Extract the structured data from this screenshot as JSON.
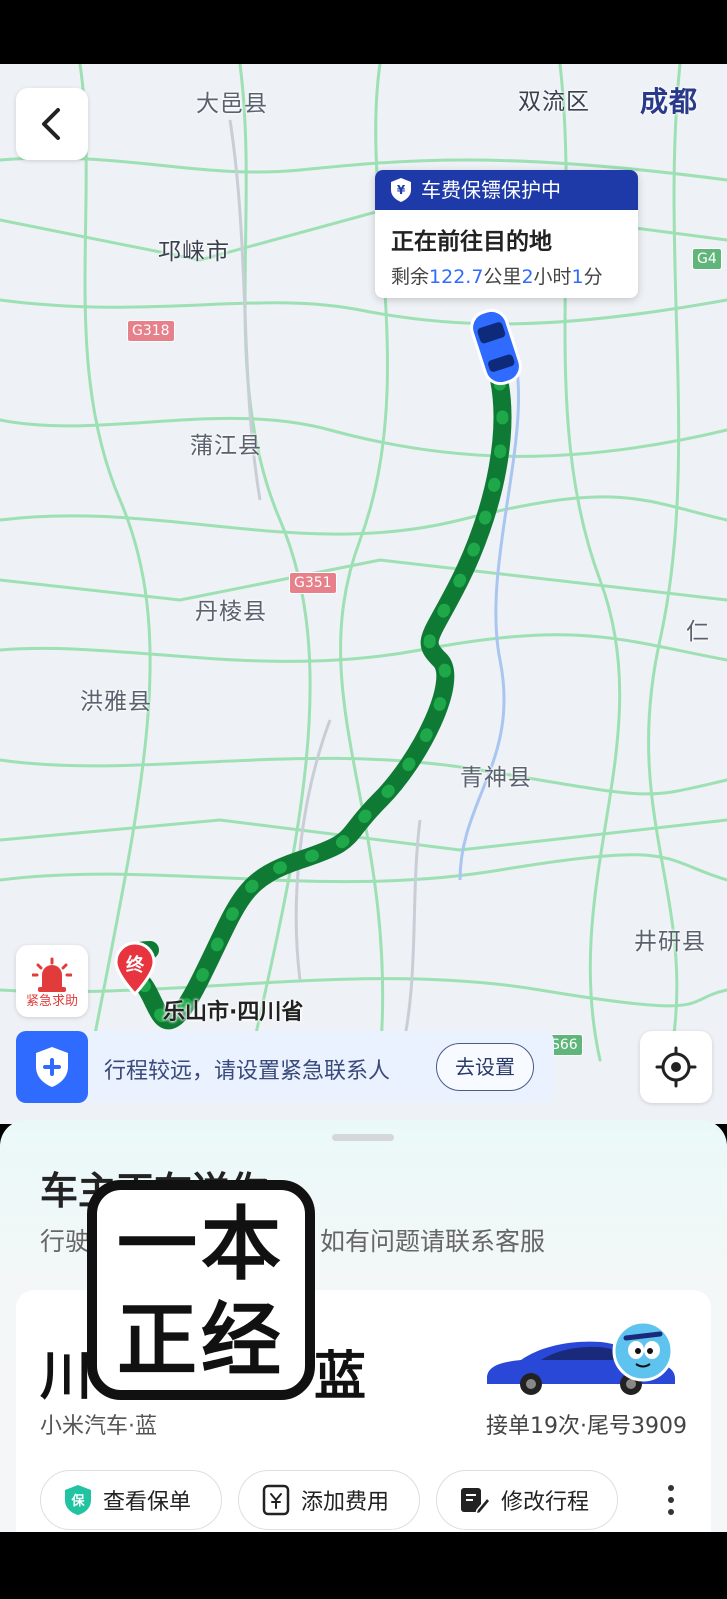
{
  "map": {
    "labels": {
      "dayi": "大邑县",
      "shuangliu": "双流区",
      "chengdu": "成都",
      "qionglai": "邛崃市",
      "pujiang": "蒲江县",
      "danleng": "丹棱县",
      "hongya": "洪雅县",
      "qingshen": "青神县",
      "jingyan": "井研县",
      "ren": "仁"
    },
    "road_signs": {
      "g318": "G318",
      "g351": "G351",
      "s66": "S66",
      "g4": "G4"
    },
    "route_color": "#1fa84a",
    "destination_marker": "终",
    "destination_label": "乐山市·四川省"
  },
  "info_card": {
    "header": "车费保镖保护中",
    "title": "正在前往目的地",
    "remain_prefix": "剩余",
    "distance": "122.7",
    "distance_unit": "公里",
    "hours": "2",
    "hours_unit": "小时",
    "minutes": "1",
    "minutes_unit": "分"
  },
  "sos": {
    "label": "紧急求助"
  },
  "emergency": {
    "text": "行程较远，请设置紧急联系人",
    "button": "去设置"
  },
  "sheet": {
    "title": "车主正在送你",
    "subtitle_prefix": "行驶",
    "subtitle_suffix": "如有问题请联系客服"
  },
  "driver": {
    "plate_prefix": "川",
    "plate_suffix": "蓝",
    "car_model": "小米汽车·蓝",
    "order_info": "接单19次·尾号3909"
  },
  "actions": {
    "policy": "查看保单",
    "policy_icon_text": "保",
    "fee": "添加费用",
    "modify": "修改行程"
  },
  "watermark": {
    "line1": "一本",
    "line2": "正经"
  },
  "colors": {
    "accent": "#2f6bff",
    "header_blue": "#1e3aa8",
    "route_green": "#1fa84a",
    "sos_red": "#e23b3b"
  }
}
